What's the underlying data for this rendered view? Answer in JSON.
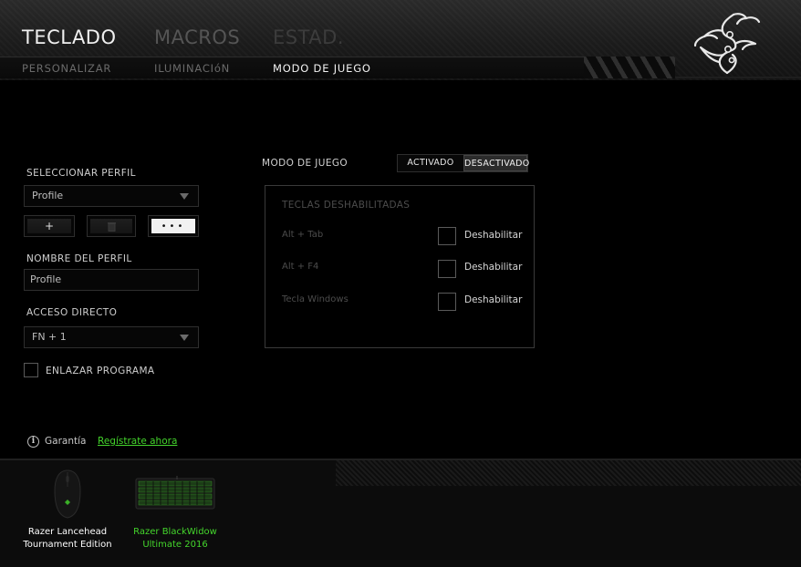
{
  "header": {
    "tabs": [
      "TECLADO",
      "MACROS",
      "ESTAD."
    ],
    "subtabs": [
      "PERSONALIZAR",
      "ILUMINACIóN",
      "MODO DE JUEGO"
    ]
  },
  "profile": {
    "select_label": "SELECCIONAR PERFIL",
    "selected": "Profile",
    "add_button": "+",
    "more_button": "•••",
    "name_label": "NOMBRE DEL PERFIL",
    "name_value": "Profile",
    "shortcut_label": "ACCESO DIRECTO",
    "shortcut_value": "FN + 1",
    "link_program_label": "ENLAZAR PROGRAMA"
  },
  "game_mode": {
    "label": "MODO DE JUEGO",
    "on": "ACTIVADO",
    "off": "DESACTIVADO",
    "selected": "off",
    "panel_title": "TECLAS DESHABILITADAS",
    "keys": [
      {
        "name": "Alt + Tab",
        "check_label": "Deshabilitar"
      },
      {
        "name": "Alt + F4",
        "check_label": "Deshabilitar"
      },
      {
        "name": "Tecla Windows",
        "check_label": "Deshabilitar"
      }
    ]
  },
  "warranty": {
    "label": "Garantía",
    "link": "Regístrate ahora"
  },
  "devices": [
    {
      "name_line1": "Razer Lancehead",
      "name_line2": "Tournament Edition",
      "color": "#ffffff"
    },
    {
      "name_line1": "Razer BlackWidow",
      "name_line2": "Ultimate 2016",
      "color": "#44d62c"
    }
  ],
  "colors": {
    "accent": "#44d62c"
  }
}
